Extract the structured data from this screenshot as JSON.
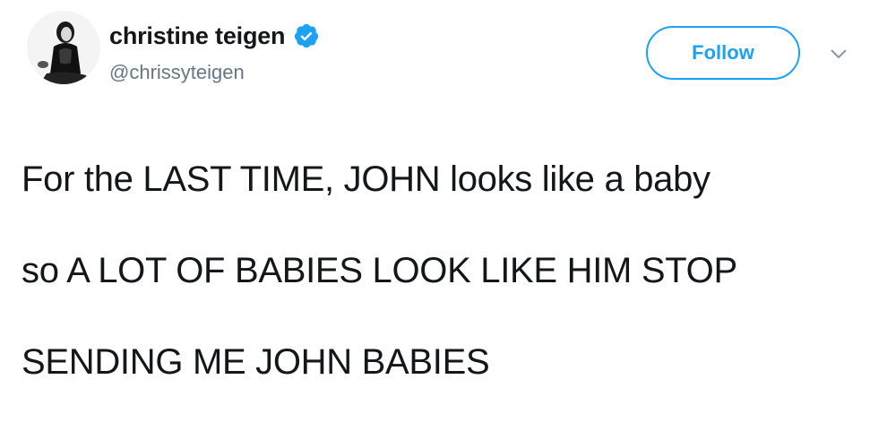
{
  "author": {
    "display_name": "christine teigen",
    "handle": "@chrissyteigen",
    "verified": true
  },
  "actions": {
    "follow_label": "Follow"
  },
  "icons": {
    "verified": "verified-badge-icon",
    "more": "chevron-down-icon",
    "avatar": "profile-photo"
  },
  "tweet": {
    "lines": [
      "For the LAST TIME, JOHN looks like a baby",
      "so A LOT OF BABIES LOOK LIKE HIM STOP",
      "SENDING ME JOHN BABIES"
    ]
  },
  "colors": {
    "accent": "#1da1f2",
    "text": "#14171a",
    "secondary": "#657786"
  }
}
